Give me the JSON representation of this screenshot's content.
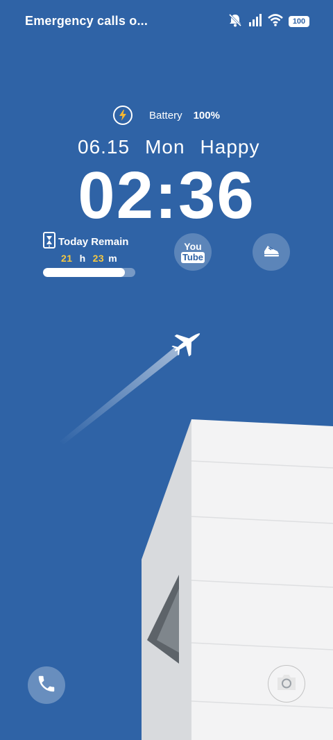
{
  "status_bar": {
    "left_text": "Emergency calls o...",
    "battery_level": "100",
    "icons": [
      "mute-bell-icon",
      "signal-icon",
      "wifi-icon",
      "battery-icon"
    ]
  },
  "battery_row": {
    "label": "Battery",
    "value": "100%",
    "icon": "charging-bolt-icon"
  },
  "date": {
    "day": "06.15",
    "weekday": "Mon",
    "greeting": "Happy"
  },
  "time": "02:36",
  "remain_widget": {
    "title": "Today Remain",
    "hours": "21",
    "hours_unit": "h",
    "minutes": "23",
    "minutes_unit": "m",
    "progress_fraction": 0.89
  },
  "shortcuts": {
    "youtube_top": "You",
    "youtube_bottom": "Tube"
  },
  "colors": {
    "background": "#2f63a6",
    "accent_yellow": "#f5c842"
  }
}
